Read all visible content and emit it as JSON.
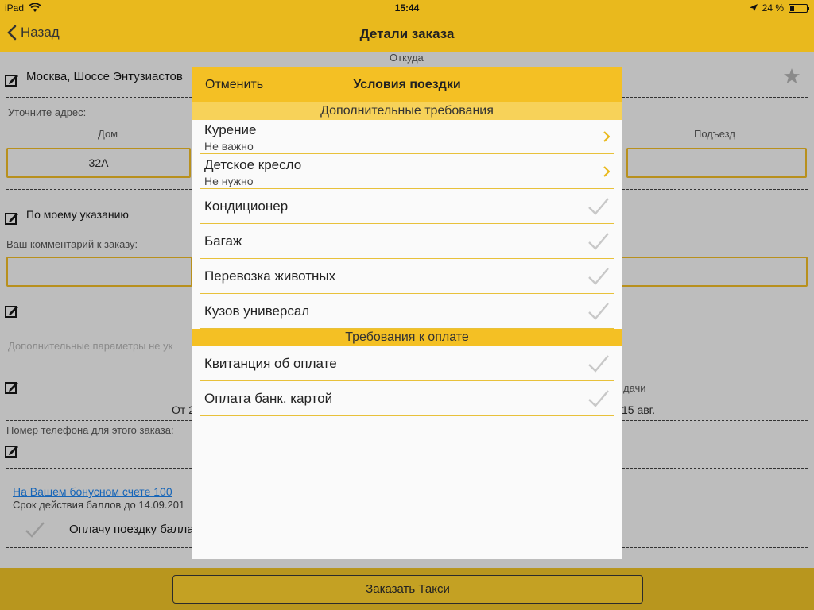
{
  "status": {
    "device": "iPad",
    "time": "15:44",
    "battery": "24 %",
    "battery_level": 0.24
  },
  "nav": {
    "back_label": "Назад",
    "title": "Детали заказа"
  },
  "form": {
    "from_label": "Откуда",
    "from_address": "Москва, Шоссе Энтузиастов",
    "clarify_label": "Уточните адрес:",
    "house_label": "Дом",
    "house_value": "32А",
    "entrance_label": "Подъезд",
    "destination": "По моему указанию",
    "comment_label": "Ваш комментарий к заказу:",
    "extra_params": "Дополнительные параметры не ук",
    "time_label_fragment": "дачи",
    "time_from_fragment": "От 2",
    "time_date_fragment": "15 авг.",
    "phone_label": "Номер телефона для этого заказа:",
    "bonus_link": "На Вашем бонусном счете 100",
    "bonus_expiry": "Срок действия баллов до 14.09.201",
    "pay_with_points": "Оплачу поездку балла"
  },
  "order_button": "Заказать Такси",
  "modal": {
    "cancel": "Отменить",
    "title": "Условия поездки",
    "section_extra": "Дополнительные требования",
    "section_payment": "Требования к оплате",
    "extra_items": [
      {
        "label": "Курение",
        "value": "Не важно"
      },
      {
        "label": "Детское кресло",
        "value": "Не нужно"
      },
      {
        "label": "Кондиционер"
      },
      {
        "label": "Багаж"
      },
      {
        "label": "Перевозка животных"
      },
      {
        "label": "Кузов универсал"
      }
    ],
    "payment_items": [
      {
        "label": "Квитанция об оплате"
      },
      {
        "label": "Оплата банк. картой"
      }
    ]
  },
  "colors": {
    "accent": "#f4c024",
    "statusbar": "#e9b91d",
    "dim_bg": "#bdbdbd",
    "link": "#1665b8"
  },
  "icons": {
    "back": "chevron-left-icon",
    "star": "star-icon",
    "edit": "edit-icon",
    "checkmark": "checkmark-icon",
    "disclosure": "chevron-right-icon"
  }
}
